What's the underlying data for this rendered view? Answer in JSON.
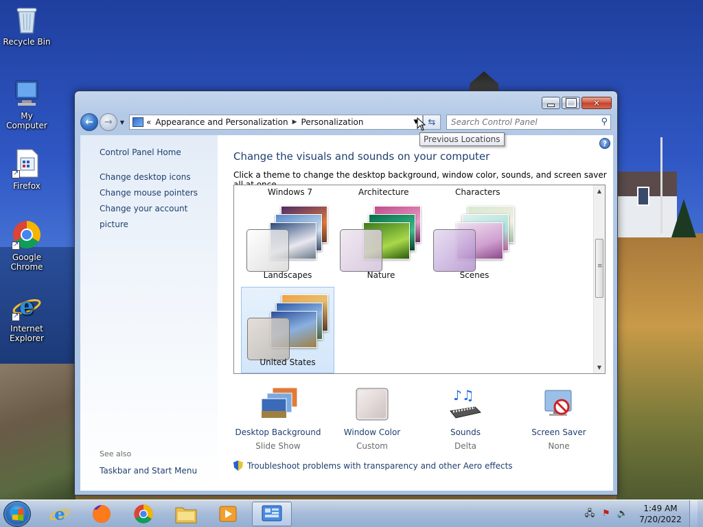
{
  "desktop": {
    "icons": [
      {
        "label": "Recycle Bin"
      },
      {
        "label": "My Computer"
      },
      {
        "label": "Firefox"
      },
      {
        "label": "Google Chrome"
      },
      {
        "label": "Internet Explorer"
      }
    ]
  },
  "window": {
    "breadcrumb": {
      "prefix": "«",
      "items": [
        "Appearance and Personalization",
        "Personalization"
      ]
    },
    "search_placeholder": "Search Control Panel",
    "tooltip": "Previous Locations",
    "help_label": "?",
    "sidebar": {
      "home": "Control Panel Home",
      "links": [
        "Change desktop icons",
        "Change mouse pointers",
        "Change your account picture"
      ],
      "see_also_heading": "See also",
      "see_also_links": [
        "Taskbar and Start Menu"
      ]
    },
    "main": {
      "title": "Change the visuals and sounds on your computer",
      "subtitle": "Click a theme to change the desktop background, window color, sounds, and screen saver all at once.",
      "partial_theme_labels": [
        "Windows 7",
        "Architecture",
        "Characters"
      ],
      "themes": [
        {
          "name": "Landscapes",
          "selected": false
        },
        {
          "name": "Nature",
          "selected": false
        },
        {
          "name": "Scenes",
          "selected": false
        },
        {
          "name": "United States",
          "selected": true
        }
      ],
      "options": [
        {
          "label": "Desktop Background",
          "value": "Slide Show"
        },
        {
          "label": "Window Color",
          "value": "Custom"
        },
        {
          "label": "Sounds",
          "value": "Delta"
        },
        {
          "label": "Screen Saver",
          "value": "None"
        }
      ],
      "troubleshoot": "Troubleshoot problems with transparency and other Aero effects"
    }
  },
  "taskbar": {
    "time": "1:49 AM",
    "date": "7/20/2022",
    "pinned": [
      "internet-explorer-icon",
      "firefox-icon",
      "chrome-icon",
      "file-explorer-icon",
      "media-player-icon",
      "control-panel-icon"
    ]
  },
  "colors": {
    "link": "#1e3f6e",
    "selection": "#d3e6fa",
    "taskbar": "#aac3e6"
  }
}
